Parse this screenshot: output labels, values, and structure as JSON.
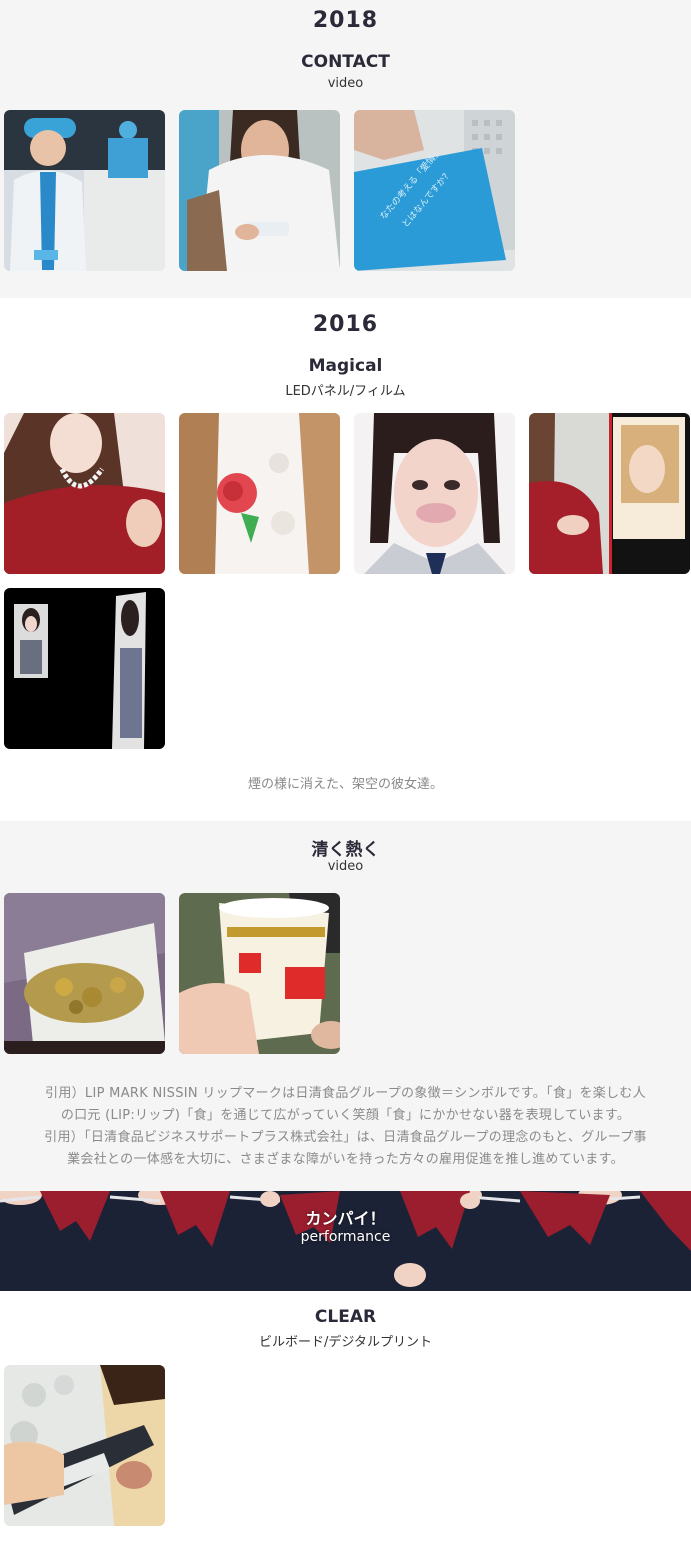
{
  "contact": {
    "year": "2018",
    "title": "CONTACT",
    "subtitle": "video",
    "thumbnails": [
      "contact-thumb-1",
      "contact-thumb-2",
      "contact-thumb-3"
    ]
  },
  "magical": {
    "year": "2016",
    "title": "Magical",
    "subtitle": "LEDパネル/フィルム",
    "description": "煙の様に消えた、架空の彼女達。"
  },
  "kiyoku": {
    "title": "清く熱く",
    "subtitle": "video",
    "quote_line1": "引用）LIP MARK NISSIN リップマークは日清食品グループの象徴＝シンボルです。「食」を楽しむ人",
    "quote_line2": "の口元 (LIP:リップ)「食」を通じて広がっていく笑顔「食」にかかせない器を表現しています。",
    "quote_line3": "引用）「日清食品ビジネスサポートプラス株式会社」は、日清食品グループの理念のもと、グループ事",
    "quote_line4": "業会社との一体感を大切に、さまざまな障がいを持った方々の雇用促進を推し進めています。"
  },
  "kanpai": {
    "title": "カンパイ！",
    "subtitle": "performance"
  },
  "clear": {
    "title": "CLEAR",
    "subtitle": "ビルボード/デジタルプリント"
  },
  "colors": {
    "gray_bg": "#f5f5f5",
    "text_dark": "#2a2a38",
    "text_muted": "#888888"
  }
}
